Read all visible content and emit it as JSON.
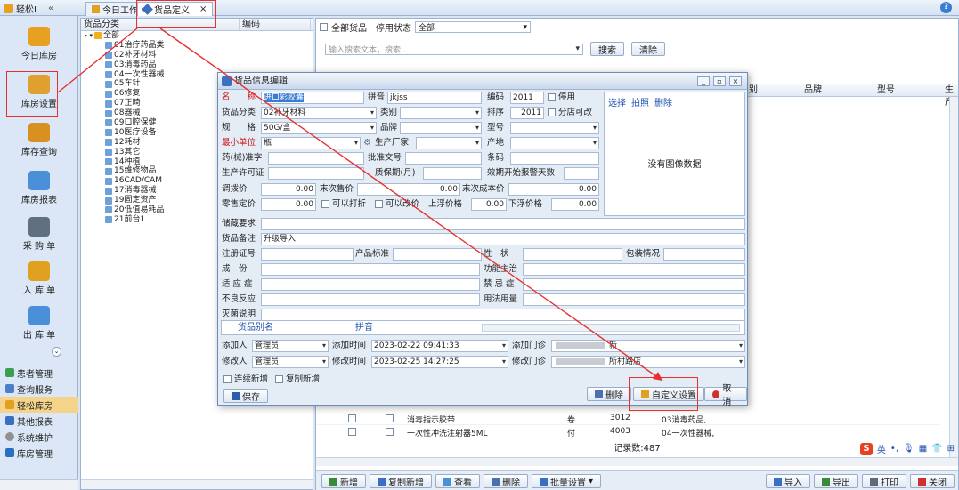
{
  "topbar": {
    "app_name": "轻松I",
    "collapse": "«",
    "tabs": [
      {
        "label": "今日工作"
      },
      {
        "label": "货品定义",
        "close": "×"
      }
    ]
  },
  "sidebar": {
    "big_items": [
      {
        "label": "今日库房",
        "color": "#e8a020"
      },
      {
        "label": "库房设置",
        "color": "#e0a030"
      },
      {
        "label": "库存查询",
        "color": "#d89020"
      },
      {
        "label": "库房报表",
        "color": "#4a90d8"
      },
      {
        "label": "采 购 单",
        "color": "#607080"
      },
      {
        "label": "入 库 单",
        "color": "#e0a020"
      },
      {
        "label": "出 库 单",
        "color": "#4a90d8"
      }
    ],
    "list_items": [
      {
        "label": "患者管理",
        "color": "#3aa050"
      },
      {
        "label": "查询服务",
        "color": "#4a80c8"
      },
      {
        "label": "轻松库房",
        "color": "#e0a020",
        "active": true
      },
      {
        "label": "其他报表",
        "color": "#3a70c0"
      },
      {
        "label": "系统维护",
        "color": "#909090"
      },
      {
        "label": "库房管理",
        "color": "#2a70c0"
      }
    ]
  },
  "tree": {
    "header": {
      "col1": "货品分类",
      "col2": "编码"
    },
    "root": "全部",
    "nodes": [
      "01治疗药品类",
      "02补牙材料",
      "03消毒药品",
      "04一次性器械",
      "05车针",
      "06修复",
      "07正畸",
      "08器械",
      "09口腔保健",
      "10医疗设备",
      "12耗材",
      "13其它",
      "14种植",
      "15维修物品",
      "16CAD/CAM",
      "17消毒器械",
      "19固定资产",
      "20低值易耗品",
      "21前台1"
    ]
  },
  "right": {
    "all_goods": "全部货品",
    "stop_status_label": "停用状态",
    "stop_status_value": "全部",
    "search_placeholder": "输入搜索文本，搜索...",
    "search_btn": "搜索",
    "clear_btn": "清除",
    "grid_headers": {
      "col_a": "别",
      "brand": "品牌",
      "model": "型号",
      "col_last": "生产"
    },
    "rows": [
      {
        "name": "消毒指示胶带",
        "unit": "卷",
        "code": "3012",
        "category": "03消毒药品,"
      },
      {
        "name": "一次性冲洗注射器5ML",
        "unit": "付",
        "code": "4003",
        "category": "04一次性器械,"
      }
    ],
    "record_count": "记录数:487",
    "ime": {
      "logo": "S",
      "lang": "英"
    },
    "bottom_buttons": [
      {
        "label": "新增",
        "name": "add-button"
      },
      {
        "label": "复制新增",
        "name": "copy-add-button"
      },
      {
        "label": "查看",
        "name": "view-button"
      },
      {
        "label": "删除",
        "name": "delete-button"
      },
      {
        "label": "批量设置",
        "name": "batch-settings-button"
      }
    ],
    "bottom_right_buttons": [
      {
        "label": "导入",
        "name": "import-button"
      },
      {
        "label": "导出",
        "name": "export-button"
      },
      {
        "label": "打印",
        "name": "print-button"
      },
      {
        "label": "关闭",
        "name": "close-button"
      }
    ]
  },
  "dialog": {
    "title": "货品信息编辑",
    "labels": {
      "name": "名　　称",
      "pinyin": "拼音",
      "code": "编码",
      "disabled": "停用",
      "category": "货品分类",
      "type": "类别",
      "sort": "排序",
      "branch_editable": "分店可改",
      "spec": "规　　格",
      "brand": "品牌",
      "model": "型号",
      "min_unit": "最小单位",
      "manufacturer": "生产厂家",
      "origin": "产地",
      "drug_license": "药(械)准字",
      "approval_no": "批准文号",
      "barcode": "条码",
      "production_license": "生产许可证",
      "shelf_life": "质保期(月)",
      "expiry_warn": "效期开始报警天数",
      "transfer_price": "调拨价",
      "last_sale": "末次售价",
      "last_cost": "末次成本价",
      "retail_price": "零售定价",
      "allow_discount": "可以打折",
      "allow_change_price": "可以改价",
      "float_up": "上浮价格",
      "float_down": "下浮价格",
      "storage": "储藏要求",
      "remarks": "货品备注",
      "reg_no": "注册证号",
      "product_std": "产品标准",
      "property": "性　状",
      "packaging": "包装情况",
      "ingredients": "成　份",
      "function": "功能主治",
      "indication": "适 应 症",
      "contraindication": "禁 忌 症",
      "adverse": "不良反应",
      "usage": "用法用量",
      "sterilization": "灭菌说明",
      "alias": "货品别名",
      "alias_pinyin": "拼音",
      "add_user": "添加人",
      "add_time": "添加时间",
      "add_branch": "添加门诊",
      "mod_user": "修改人",
      "mod_time": "修改时间",
      "mod_branch": "修改门诊",
      "continue_new": "连续新增",
      "copy_new": "复制新增"
    },
    "values": {
      "name": "进口彩胶囊",
      "pinyin": "jkjss",
      "code": "2011",
      "category": "02补牙材料",
      "sort": "2011",
      "spec": "50G/盒",
      "min_unit": "瓶",
      "transfer_price": "0.00",
      "last_sale": "0.00",
      "last_cost": "0.00",
      "retail_price": "0.00",
      "float_up": "0.00",
      "float_down": "0.00",
      "remarks": "升级导入",
      "add_user": "管理员",
      "add_time": "2023-02-22 09:41:33",
      "mod_user": "管理员",
      "mod_time": "2023-02-25 14:27:25",
      "add_branch_suffix": "新",
      "mod_branch_suffix": "所村路店"
    },
    "image_links": {
      "select": "选择",
      "capture": "拍照",
      "delete": "删除"
    },
    "no_image": "没有图像数据",
    "buttons": {
      "save": "保存",
      "delete": "删除",
      "custom_settings": "自定义设置",
      "cancel": "取消"
    },
    "window_buttons": {
      "minimize": "_",
      "restore": "▫",
      "close": "×"
    }
  }
}
